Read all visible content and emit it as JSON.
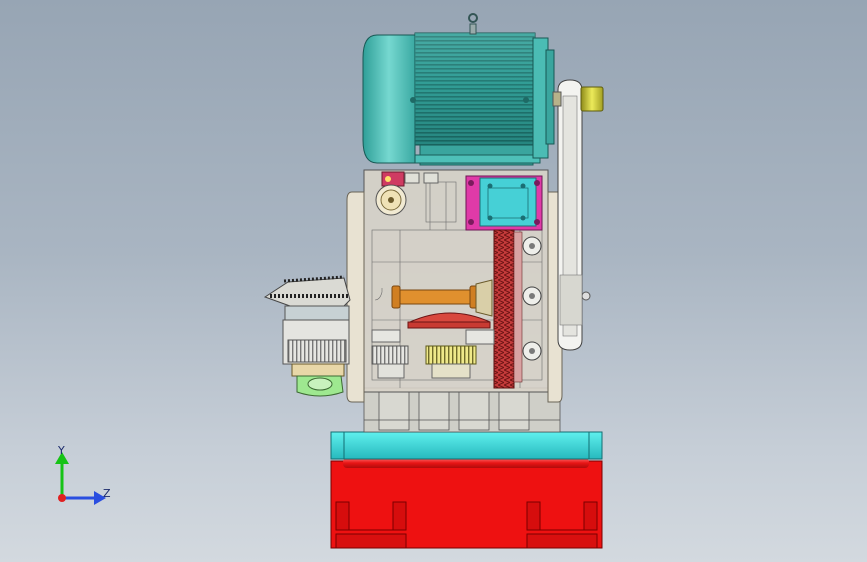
{
  "viewport": {
    "background_top": "#97a5b4",
    "background_bottom": "#d3d9df"
  },
  "model": {
    "colors": {
      "motor_body": "#3fb6ae",
      "motor_fins": "#2a8f88",
      "gearbox_frame": "#d9d2c4",
      "mount_plate_cyan": "#3fd6d6",
      "base_red": "#ee1111",
      "flange_magenta": "#e03aa8",
      "flange_cyan": "#46d0d6",
      "rack_red": "#b3262e",
      "shaft_orange": "#e0902e",
      "gear_yellow": "#e8e070",
      "bolt_yellow": "#d6d02e",
      "belt_white": "#f0f0f0"
    }
  },
  "triad": {
    "y_label": "Y",
    "z_label": "Z",
    "y_color": "#16c316",
    "z_color": "#2a4ee0",
    "origin_color": "#e02020"
  }
}
